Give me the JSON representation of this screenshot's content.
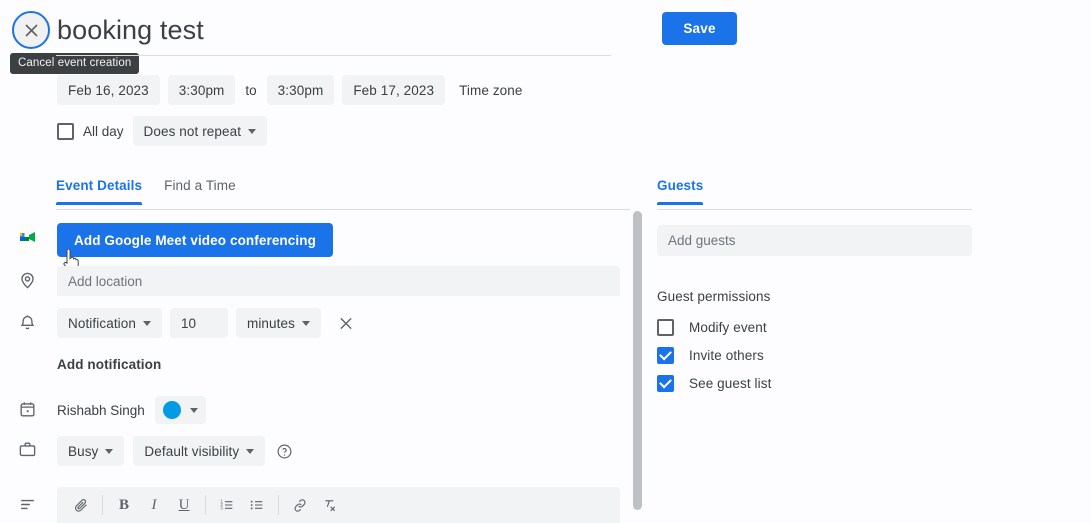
{
  "header": {
    "close_icon": "close-icon",
    "close_tooltip": "Cancel event creation",
    "title": "booking test",
    "save_label": "Save"
  },
  "schedule": {
    "start_date": "Feb 16, 2023",
    "start_time": "3:30pm",
    "to_label": "to",
    "end_time": "3:30pm",
    "end_date": "Feb 17, 2023",
    "timezone_label": "Time zone",
    "all_day_label": "All day",
    "all_day_checked": false,
    "repeat_label": "Does not repeat"
  },
  "tabs": {
    "left": [
      {
        "label": "Event Details",
        "active": true
      },
      {
        "label": "Find a Time",
        "active": false
      }
    ],
    "right": [
      {
        "label": "Guests",
        "active": true
      }
    ]
  },
  "details": {
    "meet_button": "Add Google Meet video conferencing",
    "meet_icon": "google-meet-icon",
    "location_icon": "location-pin-icon",
    "location_placeholder": "Add location",
    "location_value": "",
    "notification_icon": "bell-icon",
    "notification_type": "Notification",
    "notification_amount": "10",
    "notification_unit": "minutes",
    "remove_notification_icon": "close-icon",
    "add_notification_label": "Add notification",
    "calendar_icon": "calendar-icon",
    "owner_name": "Rishabh Singh",
    "owner_color": "#039be5",
    "busy_icon": "briefcase-icon",
    "busy_label": "Busy",
    "visibility_label": "Default visibility",
    "help_icon": "help-circle-icon",
    "description_icon": "description-lines-icon",
    "toolbar": [
      {
        "name": "attach-icon",
        "glyph": "attach"
      },
      {
        "name": "bold-icon",
        "glyph": "B"
      },
      {
        "name": "italic-icon",
        "glyph": "I"
      },
      {
        "name": "underline-icon",
        "glyph": "U"
      },
      {
        "name": "numbered-list-icon",
        "glyph": "ol"
      },
      {
        "name": "bulleted-list-icon",
        "glyph": "ul"
      },
      {
        "name": "link-icon",
        "glyph": "link"
      },
      {
        "name": "remove-formatting-icon",
        "glyph": "clear"
      }
    ]
  },
  "guests": {
    "add_guests_placeholder": "Add guests",
    "add_guests_value": "",
    "permissions_title": "Guest permissions",
    "permissions": [
      {
        "label": "Modify event",
        "checked": false
      },
      {
        "label": "Invite others",
        "checked": true
      },
      {
        "label": "See guest list",
        "checked": true
      }
    ]
  },
  "colors": {
    "accent": "#1a73e8",
    "chip_bg": "#f1f3f4",
    "text": "#3c4043",
    "muted": "#5f6368",
    "tooltip_bg": "#3c4043"
  }
}
